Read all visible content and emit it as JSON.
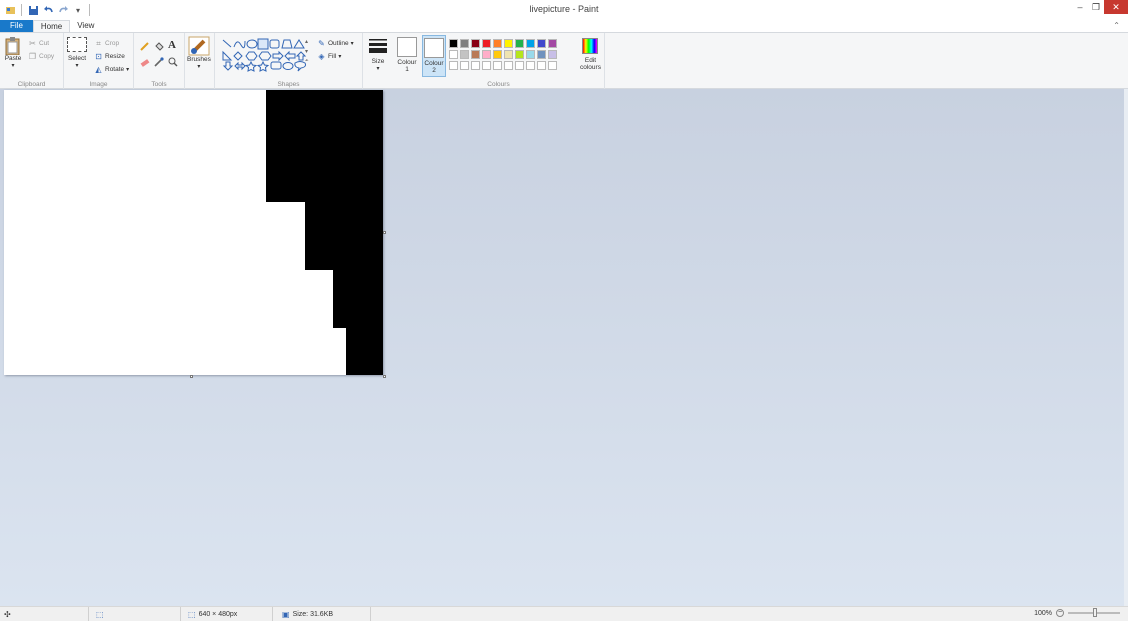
{
  "window": {
    "title": "livepicture - Paint",
    "minimize_icon": "minimize-icon",
    "restore_icon": "restore-icon",
    "close_icon": "close-icon",
    "collapse_ribbon_icon": "chevron-up-icon"
  },
  "qat": {
    "icons": [
      "paint-app-icon",
      "save-icon",
      "undo-icon",
      "redo-icon",
      "customize-qat-icon"
    ]
  },
  "tabs": [
    {
      "label": "File"
    },
    {
      "label": "Home"
    },
    {
      "label": "View"
    }
  ],
  "ribbon": {
    "clipboard": {
      "label": "Clipboard",
      "paste": "Paste",
      "cut": "Cut",
      "copy": "Copy"
    },
    "image": {
      "label": "Image",
      "select": "Select",
      "crop": "Crop",
      "resize": "Resize",
      "rotate": "Rotate"
    },
    "tools": {
      "label": "Tools"
    },
    "brushes": {
      "label": "Brushes"
    },
    "shapes": {
      "label": "Shapes",
      "outline": "Outline",
      "fill": "Fill"
    },
    "size": {
      "label": "Size"
    },
    "colours": {
      "label": "Colours",
      "colour1_line1": "Colour",
      "colour1_line2": "1",
      "colour2_line1": "Colour",
      "colour2_line2": "2",
      "edit_line1": "Edit",
      "edit_line2": "colours",
      "colour1_value": "#000000",
      "colour2_value": "#ffffff",
      "row1": [
        "#000000",
        "#7f7f7f",
        "#880015",
        "#ed1c24",
        "#ff7f27",
        "#fff200",
        "#22b14c",
        "#00a2e8",
        "#3f48cc",
        "#a349a4"
      ],
      "row2": [
        "#ffffff",
        "#c3c3c3",
        "#b97a57",
        "#ffaec9",
        "#ffc90e",
        "#efe4b0",
        "#b5e61d",
        "#99d9ea",
        "#7092be",
        "#c8bfe7"
      ],
      "row3": [
        "#ffffff",
        "#ffffff",
        "#ffffff",
        "#ffffff",
        "#ffffff",
        "#ffffff",
        "#ffffff",
        "#ffffff",
        "#ffffff",
        "#ffffff"
      ]
    }
  },
  "statusbar": {
    "dimensions": "640 × 480px",
    "size": "Size: 31.6KB",
    "zoom": "100%"
  }
}
